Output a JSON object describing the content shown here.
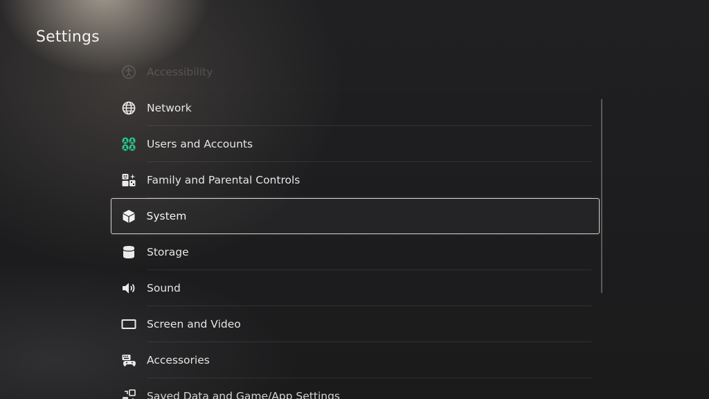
{
  "header": {
    "title": "Settings"
  },
  "menu": {
    "items": [
      {
        "label": "Accessibility",
        "icon": "accessibility-icon",
        "state": "faded"
      },
      {
        "label": "Network",
        "icon": "globe-icon"
      },
      {
        "label": "Users and Accounts",
        "icon": "users-accounts-icon",
        "icon_color": "#2fc38f"
      },
      {
        "label": "Family and Parental Controls",
        "icon": "family-icon"
      },
      {
        "label": "System",
        "icon": "cube-icon",
        "state": "selected"
      },
      {
        "label": "Storage",
        "icon": "storage-icon"
      },
      {
        "label": "Sound",
        "icon": "speaker-icon"
      },
      {
        "label": "Screen and Video",
        "icon": "screen-icon"
      },
      {
        "label": "Accessories",
        "icon": "accessories-icon"
      },
      {
        "label": "Saved Data and Game/App Settings",
        "icon": "saved-data-icon",
        "state": "cut-off"
      }
    ]
  },
  "colors": {
    "selection_border": "#d8d2c6",
    "accent_green": "#2fc38f",
    "text": "#e6e6e6"
  }
}
